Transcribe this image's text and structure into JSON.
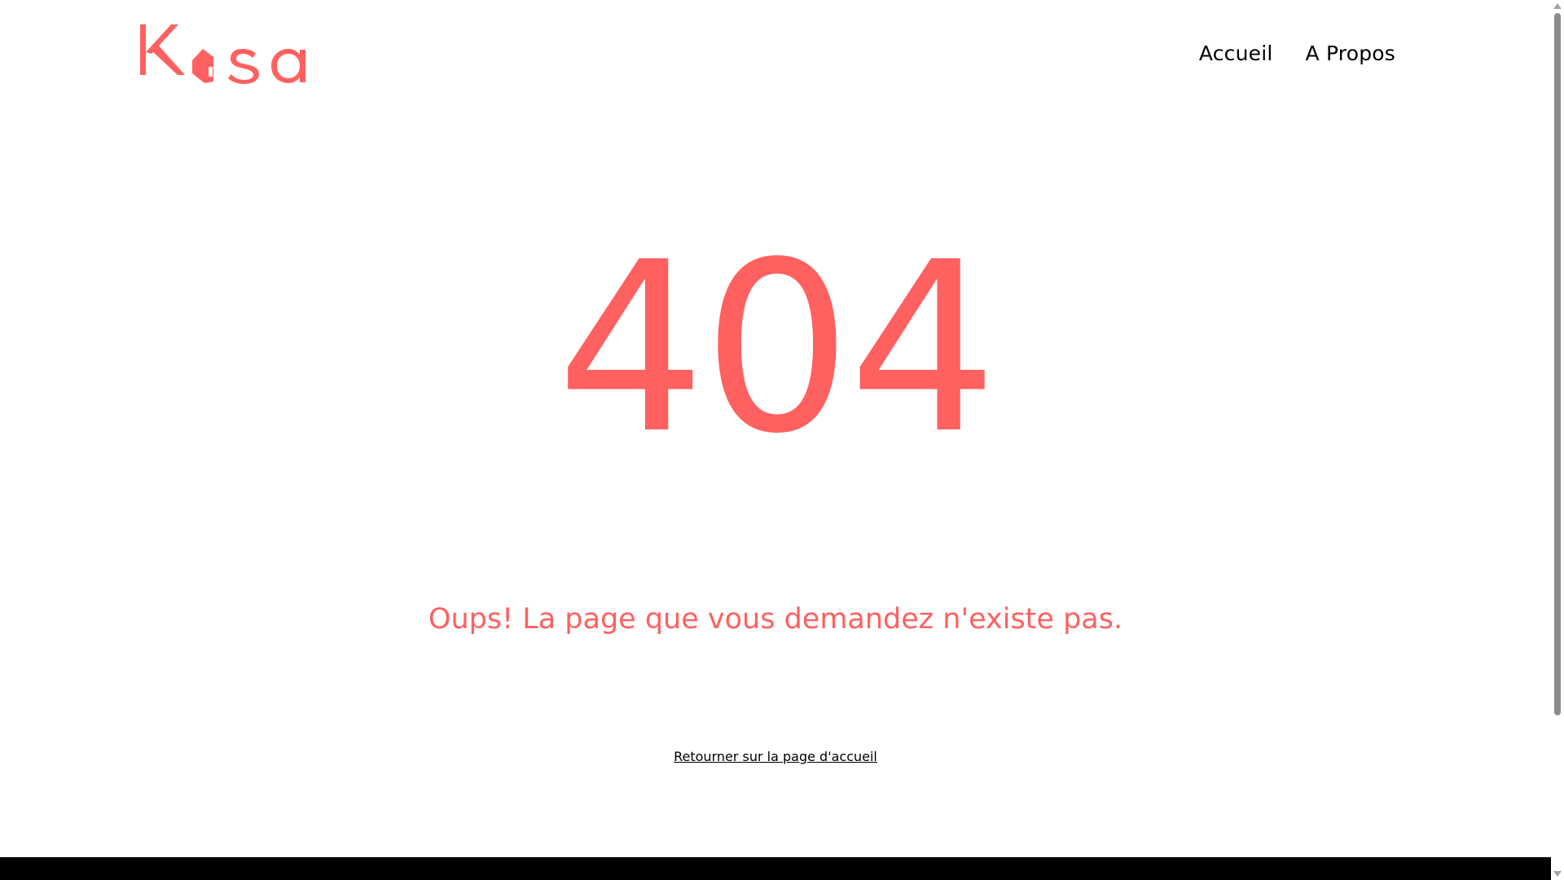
{
  "brand": {
    "logo_text": "Kasa",
    "accent_color": "#ff6060"
  },
  "nav": {
    "items": [
      {
        "label": "Accueil"
      },
      {
        "label": "A Propos"
      }
    ]
  },
  "error": {
    "code": "404",
    "message": "Oups! La page que vous demandez n'existe pas.",
    "home_link_label": "Retourner sur la page d'accueil"
  }
}
